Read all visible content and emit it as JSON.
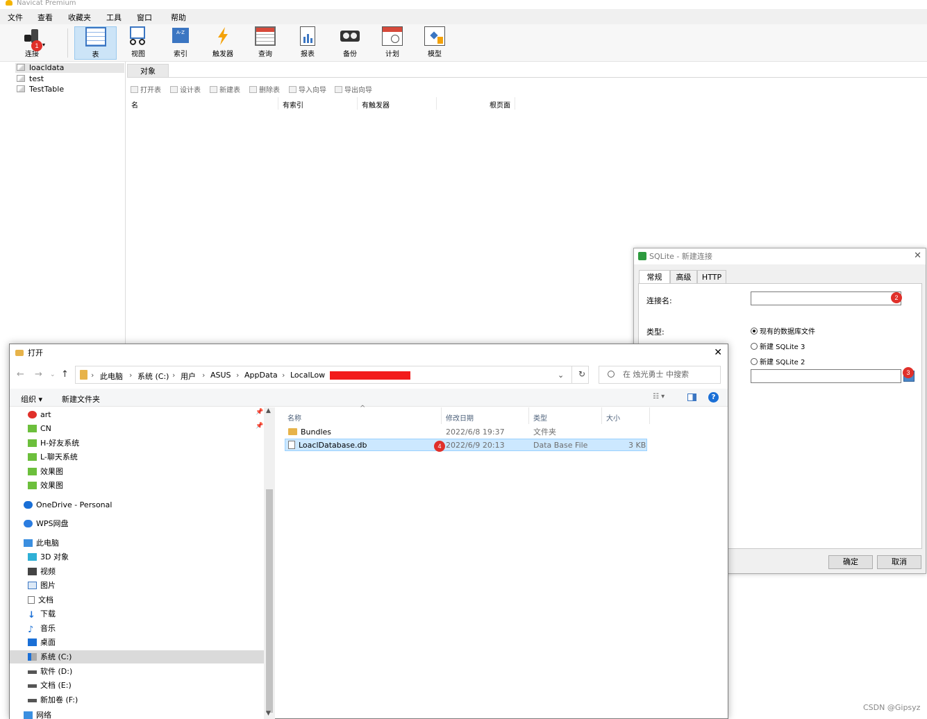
{
  "app": {
    "title": "Navicat Premium"
  },
  "menu": [
    "文件",
    "查看",
    "收藏夹",
    "工具",
    "窗口",
    "帮助"
  ],
  "toolbar": {
    "connect_label": "连接",
    "items": [
      "表",
      "视图",
      "索引",
      "触发器",
      "查询",
      "报表",
      "备份",
      "计划",
      "模型"
    ]
  },
  "badges": {
    "b1": "1",
    "b2": "2",
    "b3": "3",
    "b4": "4"
  },
  "tree": [
    "loacldata",
    "test",
    "TestTable"
  ],
  "object_tab": "对象",
  "object_tools": [
    "打开表",
    "设计表",
    "新建表",
    "删除表",
    "导入向导",
    "导出向导"
  ],
  "object_columns": [
    "名",
    "有索引",
    "有触发器",
    "根页面"
  ],
  "sqlite_dialog": {
    "title": "SQLite - 新建连接",
    "tabs": [
      "常规",
      "高级",
      "HTTP"
    ],
    "connection_name_label": "连接名:",
    "type_label": "类型:",
    "radio_existing": "现有的数据库文件",
    "radio_sqlite3": "新建 SQLite 3",
    "radio_sqlite2": "新建 SQLite 2",
    "ok": "确定",
    "cancel": "取消"
  },
  "open_dialog": {
    "title": "打开",
    "breadcrumb": [
      "此电脑",
      "系统 (C:)",
      "用户",
      "ASUS",
      "AppData",
      "LocalLow"
    ],
    "search_placeholder": "在 烛光勇士 中搜索",
    "organize": "组织 ▾",
    "new_folder": "新建文件夹",
    "nav": {
      "quick": [
        "art",
        "CN",
        "H-好友系统",
        "L-聊天系统",
        "效果图",
        "效果图"
      ],
      "onedrive": "OneDrive - Personal",
      "wps": "WPS网盘",
      "this_pc": "此电脑",
      "pc_items": [
        "3D 对象",
        "视频",
        "图片",
        "文档",
        "下载",
        "音乐",
        "桌面",
        "系统 (C:)",
        "软件 (D:)",
        "文档 (E:)",
        "新加卷 (F:)"
      ],
      "network": "网络"
    },
    "columns": [
      "名称",
      "修改日期",
      "类型",
      "大小"
    ],
    "files": [
      {
        "name": "Bundles",
        "date": "2022/6/8 19:37",
        "type": "文件夹",
        "size": ""
      },
      {
        "name": "LoaclDatabase.db",
        "date": "2022/6/9 20:13",
        "type": "Data Base File",
        "size": "3 KB"
      }
    ]
  },
  "watermark": "CSDN @Gipsyz",
  "colors": {
    "accent": "#0078d7",
    "badge": "#e0302a",
    "selection": "#cce8ff",
    "redact": "#f21b1b"
  }
}
